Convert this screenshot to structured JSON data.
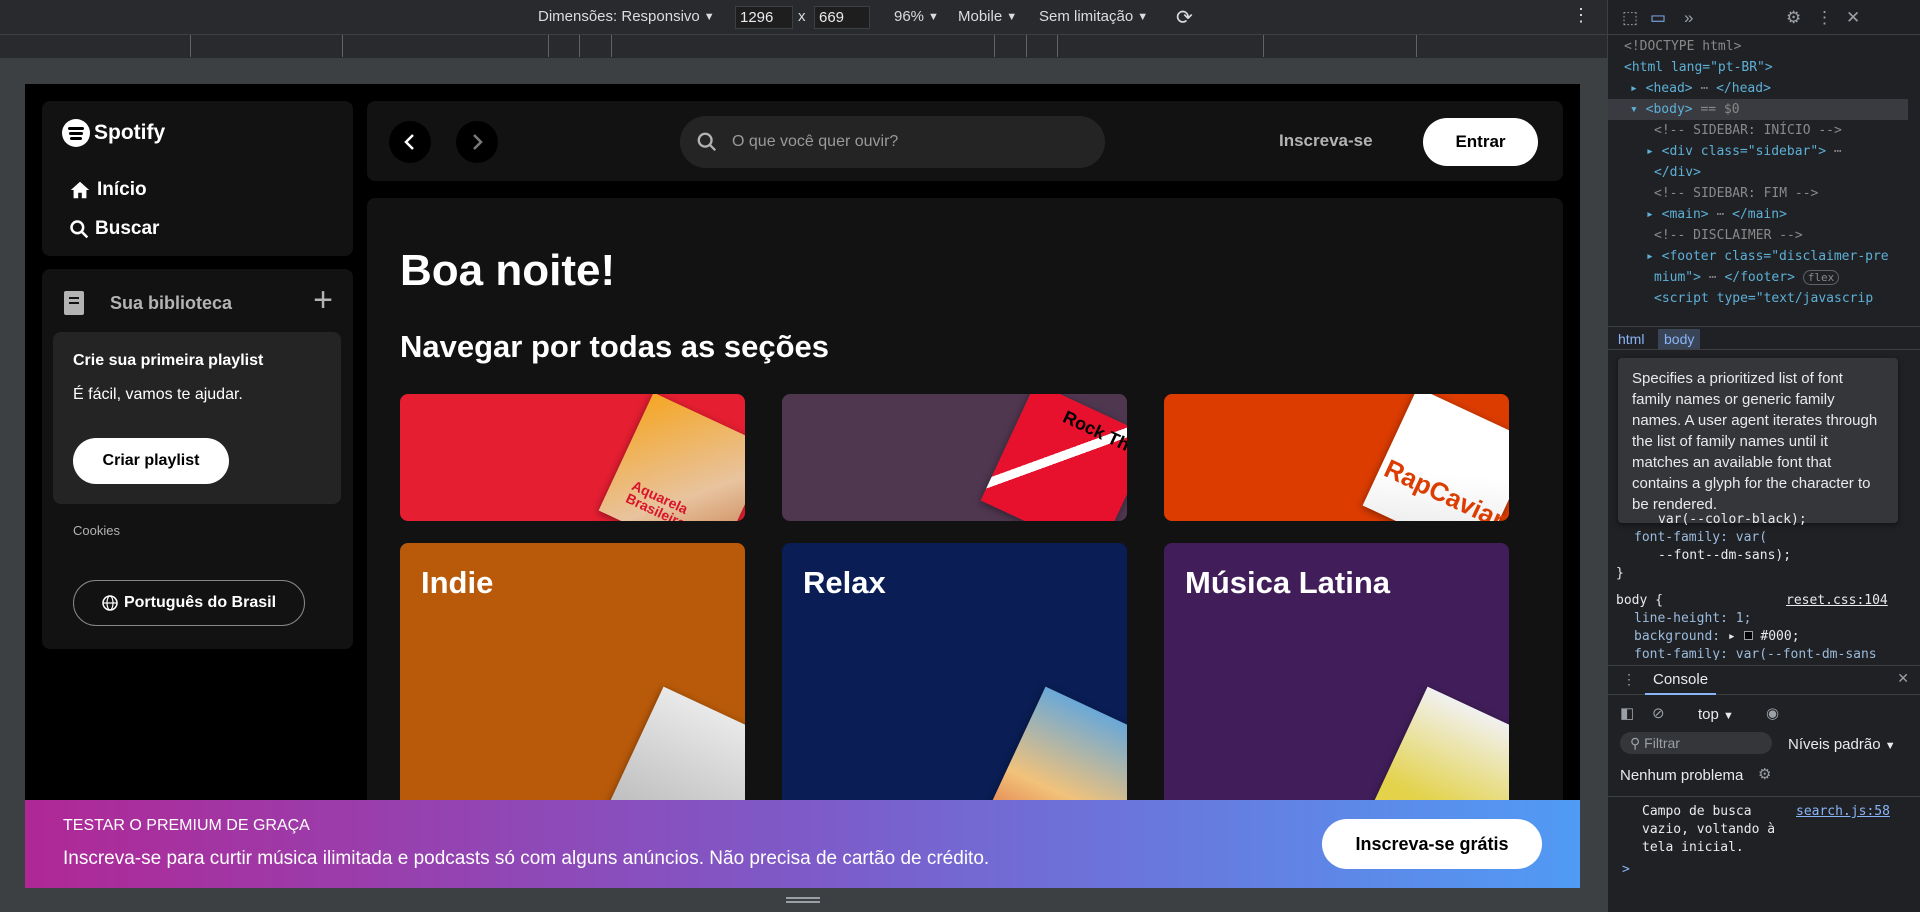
{
  "device_toolbar": {
    "dimensions_label": "Dimensões: Responsivo",
    "width": "1296",
    "height": "669",
    "times": "x",
    "zoom": "96%",
    "device_type": "Mobile",
    "throttling": "Sem limitação"
  },
  "spotify": {
    "logo_text": "Spotify",
    "nav": {
      "home": "Início",
      "search": "Buscar"
    },
    "library": {
      "title": "Sua biblioteca",
      "card_title": "Crie sua primeira playlist",
      "card_subtitle": "É fácil, vamos te ajudar.",
      "card_button": "Criar playlist",
      "cookies": "Cookies",
      "language_button": "Português do Brasil"
    },
    "topbar": {
      "search_placeholder": "O que você quer ouvir?",
      "signup": "Inscreva-se",
      "login": "Entrar"
    },
    "main": {
      "greeting": "Boa noite!",
      "section_title": "Navegar por todas as seções",
      "cards_row1": [
        {
          "color": "#e61e32",
          "art_text": "Aquarela Brasileira"
        },
        {
          "color": "#503750",
          "art_text": "Rock This"
        },
        {
          "color": "#dc3c00",
          "art_text": "RapCaviar"
        }
      ],
      "cards_row2": [
        {
          "label": "Indie",
          "color": "#b95a0a"
        },
        {
          "label": "Relax",
          "color": "#0a1e55"
        },
        {
          "label": "Música Latina",
          "color": "#411e5a"
        }
      ]
    },
    "banner": {
      "title": "TESTAR O PREMIUM DE GRAÇA",
      "subtitle": "Inscreva-se para curtir música ilimitada e podcasts só com alguns anúncios. Não precisa de cartão de crédito.",
      "button": "Inscreva-se grátis"
    }
  },
  "devtools": {
    "elements": {
      "doctype": "<!DOCTYPE html>",
      "html_open": "<html lang=\"pt-BR\">",
      "head": "<head>",
      "head_close": "</head>",
      "body": "<body>",
      "body_marker": "== $0",
      "comment_sidebar_start": "<!-- SIDEBAR: INÍCIO -->",
      "div_sidebar": "<div class=\"sidebar\">",
      "div_close": "</div>",
      "comment_sidebar_end": "<!-- SIDEBAR: FIM -->",
      "main": "<main>",
      "main_close": "</main>",
      "comment_disclaimer": "<!-- DISCLAIMER -->",
      "footer_a": "<footer class=\"disclaimer-pre",
      "footer_b": "mium\">",
      "footer_close": "</footer>",
      "flex_badge": "flex",
      "script": "<script type=\"text/javascrip"
    },
    "breadcrumbs": [
      "html",
      "body"
    ],
    "tooltip": "Specifies a prioritized list of font family names or generic family names. A user agent iterates through the list of family names until it matches an available font that contains a glyph for the character to be rendered.",
    "styles": {
      "line1": "var(--color-black);",
      "line2": "font-family: var(",
      "line3": "--font--dm-sans);",
      "line4": "}",
      "rule_selector": "body {",
      "rule_source": "reset.css:104",
      "prop1": "line-height: 1;",
      "prop2_name": "background:",
      "prop2_val": "#000;",
      "prop3": "font-family: var(--font-dm-sans"
    },
    "console": {
      "tab": "Console",
      "context": "top",
      "filter_placeholder": "Filtrar",
      "levels": "Níveis padrão",
      "issues": "Nenhum problema",
      "message": "Campo de busca vazio, voltando à tela inicial.",
      "message_source": "search.js:58",
      "prompt": ">"
    }
  }
}
